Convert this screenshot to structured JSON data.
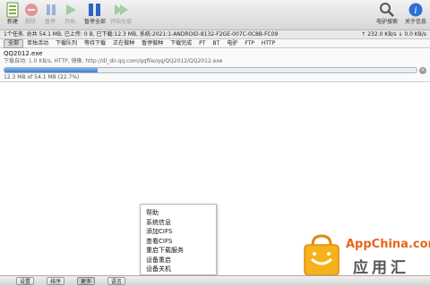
{
  "toolbar": {
    "buttons": [
      {
        "label": "新建",
        "icon": "new-icon",
        "disabled": false
      },
      {
        "label": "删除",
        "icon": "delete-icon",
        "disabled": true
      },
      {
        "label": "暂停",
        "icon": "pause-icon",
        "disabled": true
      },
      {
        "label": "开始",
        "icon": "start-icon",
        "disabled": true
      },
      {
        "label": "暂停全部",
        "icon": "pause-all-icon",
        "disabled": false
      },
      {
        "label": "开始全部",
        "icon": "start-all-icon",
        "disabled": true
      }
    ],
    "right_buttons": [
      {
        "label": "电驴搜索",
        "icon": "search-icon"
      },
      {
        "label": "关于信息",
        "icon": "info-icon"
      }
    ]
  },
  "status": {
    "left": "1个任务. 总共 54.1 MB, 已上传: 0 B, 已下载:12.3 MB, 系统:2021:1-ANDROID-8132-F2GE-007C-0C8B-FC09",
    "right": "↑ 232.0 KB/s   ↓ 0.0 KB/s"
  },
  "tabs": [
    "全部",
    "单独活动",
    "下载队列",
    "等待下载",
    "正在做种",
    "暂停做种",
    "下载完成",
    "PT",
    "BT",
    "电驴",
    "FTP",
    "HTTP"
  ],
  "download": {
    "name": "QQ2012.exe",
    "url": "下载自动: 1.0 KB/s, HTTP, 镜像, http://dl_dir.qq.com/qqfile/qq/QQ2012/QQ2012.exe",
    "size": "12.3 MB of 54.1 MB (22.7%)",
    "progress": 0.227
  },
  "menu": {
    "items": [
      "帮助",
      "系统信息",
      "添加CIFS",
      "查看CIFS",
      "重启下载服务",
      "设备重启",
      "设备关机"
    ]
  },
  "bottom": {
    "buttons": [
      "设置",
      "排序",
      "更多",
      "语言"
    ]
  },
  "watermark": {
    "brand": "AppChina.com",
    "chinese": "应用汇"
  },
  "colors": {
    "progress": "#3d7fd3",
    "watermark_orange": "#e8641c"
  }
}
